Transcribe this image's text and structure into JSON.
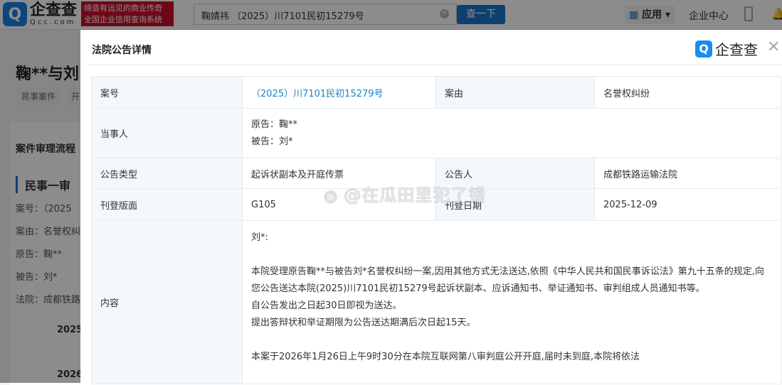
{
  "topbar": {
    "logo": "企查查",
    "logo_sub": "Qcc.com",
    "slogan_1": "缔造有远见的商业传奇",
    "slogan_2": "全国企业信用查询系统",
    "search_value": "鞠婧祎 （2025）川7101民初15279号",
    "search_button": "查一下",
    "apps": "应用",
    "enterprise_center": "企业中心"
  },
  "background": {
    "title": "鞠**与刘",
    "tags": [
      "民事案件",
      "开"
    ],
    "section": "案件审理流程",
    "trial": "民事一审",
    "rows": [
      "案号：（2025",
      "案由：名誉权纠",
      "原告：鞠**",
      "被告：刘*",
      "法院：成都铁路"
    ],
    "years": [
      "2025",
      "2026"
    ]
  },
  "modal": {
    "title": "法院公告详情",
    "brand": "企查查",
    "case_no_label": "案号",
    "case_no": "（2025）川7101民初15279号",
    "cause_label": "案由",
    "cause": "名誉权纠纷",
    "parties_label": "当事人",
    "plaintiff": "原告：鞠**",
    "defendant": "被告：刘*",
    "type_label": "公告类型",
    "type": "起诉状副本及开庭传票",
    "announcer_label": "公告人",
    "announcer": "成都铁路运输法院",
    "page_label": "刊登版面",
    "page": "G105",
    "date_label": "刊登日期",
    "date": "2025-12-09",
    "content_label": "内容",
    "content": [
      "刘*:",
      "",
      "本院受理原告鞠**与被告刘*名誉权纠纷一案,因用其他方式无法送达,依照《中华人民共和国民事诉讼法》第九十五条的规定,向您公告送达本院(2025)川7101民初15279号起诉状副本、应诉通知书、举证通知书、审判组成人员通知书等。",
      "自公告发出之日起30日即视为送达。",
      "提出答辩状和举证期限为公告送达期满后次日起15天。",
      "",
      "本案于2026年1月26日上午9时30分在本院互联网第八审判庭公开开庭,届时未到庭,本院将依法"
    ]
  },
  "watermark": "@在瓜田里犯了错"
}
